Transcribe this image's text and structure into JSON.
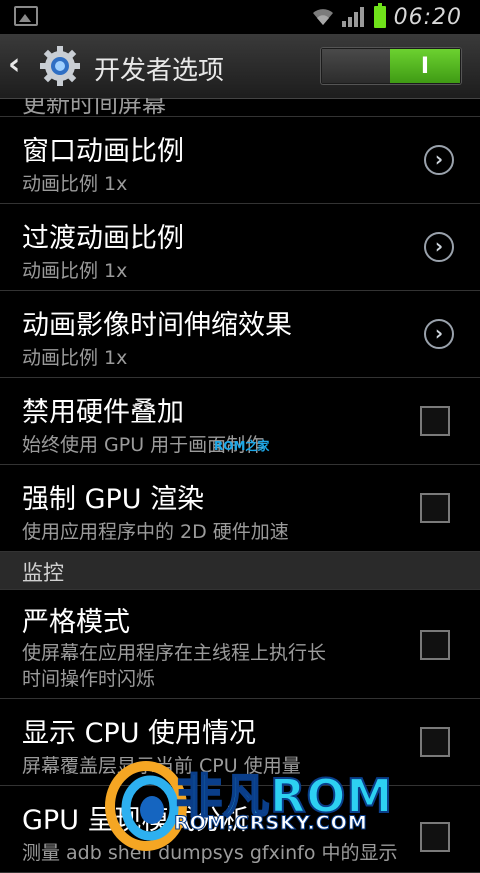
{
  "status_bar": {
    "time": "06:20",
    "icons": [
      "image-icon",
      "wifi-icon",
      "signal-icon",
      "battery-icon"
    ]
  },
  "action_bar": {
    "title": "开发者选项",
    "toggle_label": "I"
  },
  "list": {
    "cut_off_item": "更新时间屏幕",
    "items": [
      {
        "title": "窗口动画比例",
        "subtitle": "动画比例 1x",
        "control": "chevron"
      },
      {
        "title": "过渡动画比例",
        "subtitle": "动画比例 1x",
        "control": "chevron"
      },
      {
        "title": "动画影像时间伸缩效果",
        "subtitle": "动画比例 1x",
        "control": "chevron"
      },
      {
        "title": "禁用硬件叠加",
        "subtitle": "始终使用 GPU 用于画面制作",
        "control": "checkbox",
        "checked": false
      },
      {
        "title": "强制 GPU 渲染",
        "subtitle": "使用应用程序中的 2D 硬件加速",
        "control": "checkbox",
        "checked": false
      }
    ],
    "section": "监控",
    "items2": [
      {
        "title": "严格模式",
        "subtitle_line1": "使屏幕在应用程序在主线程上执行长",
        "subtitle_line2": "时间操作时闪烁",
        "control": "checkbox",
        "checked": false
      },
      {
        "title": "显示 CPU 使用情况",
        "subtitle": "屏幕覆盖层显示当前 CPU 使用量",
        "control": "checkbox",
        "checked": false
      },
      {
        "title": "GPU 呈现模式分析",
        "subtitle": "测量 adb shell dumpsys gfxinfo 中的显示",
        "control": "checkbox",
        "checked": false
      }
    ]
  },
  "watermark": {
    "mid_text": "ROM之家",
    "brand": "非凡ROM",
    "url": "ROM.CRSKY.COM"
  },
  "colors": {
    "accent_green": "#5cc324",
    "text_secondary": "#9b9b9b",
    "watermark_blue": "#2dd0f2"
  }
}
